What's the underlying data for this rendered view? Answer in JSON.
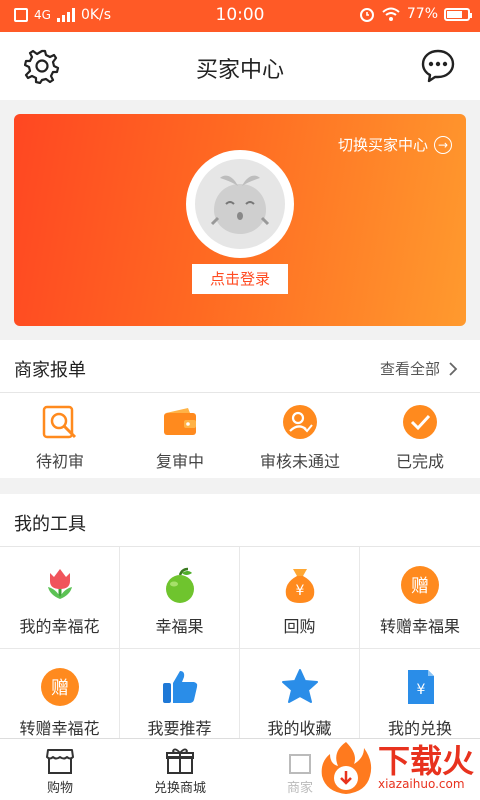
{
  "status_bar": {
    "network": "4G",
    "speed": "0K/s",
    "time": "10:00",
    "battery": "77%",
    "battery_level": 0.77
  },
  "header": {
    "title": "买家中心"
  },
  "banner": {
    "switch_label": "切换买家中心",
    "login_label": "点击登录"
  },
  "reports": {
    "title": "商家报单",
    "view_all": "查看全部",
    "items": [
      {
        "label": "待初审",
        "icon": "search-doc-icon"
      },
      {
        "label": "复审中",
        "icon": "wallet-icon"
      },
      {
        "label": "审核未通过",
        "icon": "user-circle-icon"
      },
      {
        "label": "已完成",
        "icon": "check-circle-icon"
      }
    ]
  },
  "tools": {
    "title": "我的工具",
    "items": [
      {
        "label": "我的幸福花",
        "icon": "tulip-icon"
      },
      {
        "label": "幸福果",
        "icon": "apple-icon"
      },
      {
        "label": "回购",
        "icon": "money-bag-icon",
        "glyph": "¥"
      },
      {
        "label": "转赠幸福果",
        "icon": "gift-coin-icon",
        "glyph": "赠"
      },
      {
        "label": "转赠幸福花",
        "icon": "gift-coin-icon",
        "glyph": "赠"
      },
      {
        "label": "我要推荐",
        "icon": "thumbs-up-icon"
      },
      {
        "label": "我的收藏",
        "icon": "star-icon"
      },
      {
        "label": "我的兑换",
        "icon": "receipt-icon",
        "glyph": "¥"
      }
    ]
  },
  "tabbar": {
    "items": [
      {
        "label": "购物",
        "icon": "shop-icon"
      },
      {
        "label": "兑换商城",
        "icon": "gift-box-icon"
      },
      {
        "label": "商家",
        "icon": "store-icon"
      },
      {
        "label": "",
        "icon": "user-icon"
      }
    ]
  },
  "watermark": {
    "brand": "下载火",
    "domain": "xiazaihuo.com"
  },
  "colors": {
    "accent": "#ff5a26",
    "banner_start": "#ff4722",
    "banner_end": "#ff9a2e",
    "icon_orange": "#ff8a1e",
    "icon_blue": "#2a8de8",
    "icon_green": "#66bb2a"
  }
}
